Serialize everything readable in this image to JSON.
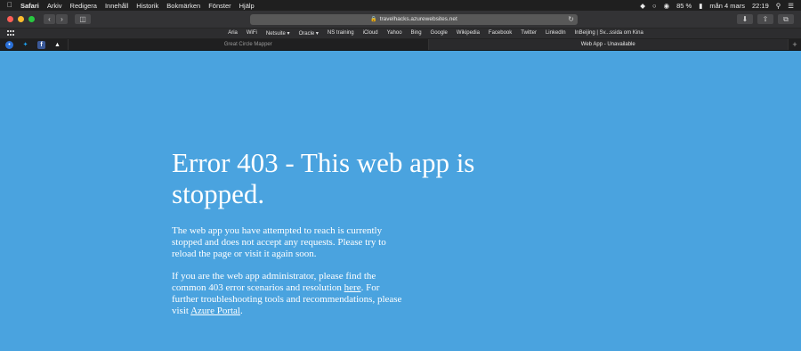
{
  "menubar": {
    "app": "Safari",
    "items": [
      "Arkiv",
      "Redigera",
      "Innehåll",
      "Historik",
      "Bokmärken",
      "Fönster",
      "Hjälp"
    ],
    "battery": "85 %",
    "date": "mån 4 mars",
    "time": "22:19"
  },
  "toolbar": {
    "url": "travelhacks.azurewebsites.net",
    "lights": {
      "close": "#fe5f57",
      "minimize": "#febc2e",
      "zoom": "#28c840"
    }
  },
  "favorites": [
    "Aria",
    "WiFi",
    "Netsuite ▾",
    "Oracle ▾",
    "NS training",
    "iCloud",
    "Yahoo",
    "Bing",
    "Google",
    "Wikipedia",
    "Facebook",
    "Twitter",
    "LinkedIn",
    "InBeijing | Sv...ssida om Kina"
  ],
  "tabs": {
    "pinned": [
      "browser-icon",
      "twitter-icon",
      "facebook-icon",
      "bird-icon"
    ],
    "items": [
      {
        "label": "Great Circle Mapper",
        "active": false
      },
      {
        "label": "Web App - Unavailable",
        "active": true
      }
    ]
  },
  "page": {
    "background": "#4aa3df",
    "heading": "Error 403 - This web app is stopped.",
    "para1": "The web app you have attempted to reach is currently stopped and does not accept any requests. Please try to reload the page or visit it again soon.",
    "para2_a": "If you are the web app administrator, please find the common 403 error scenarios and resolution ",
    "link_here": "here",
    "para2_b": ". For further troubleshooting tools and recommendations, please visit ",
    "link_portal": "Azure Portal",
    "para2_c": "."
  }
}
